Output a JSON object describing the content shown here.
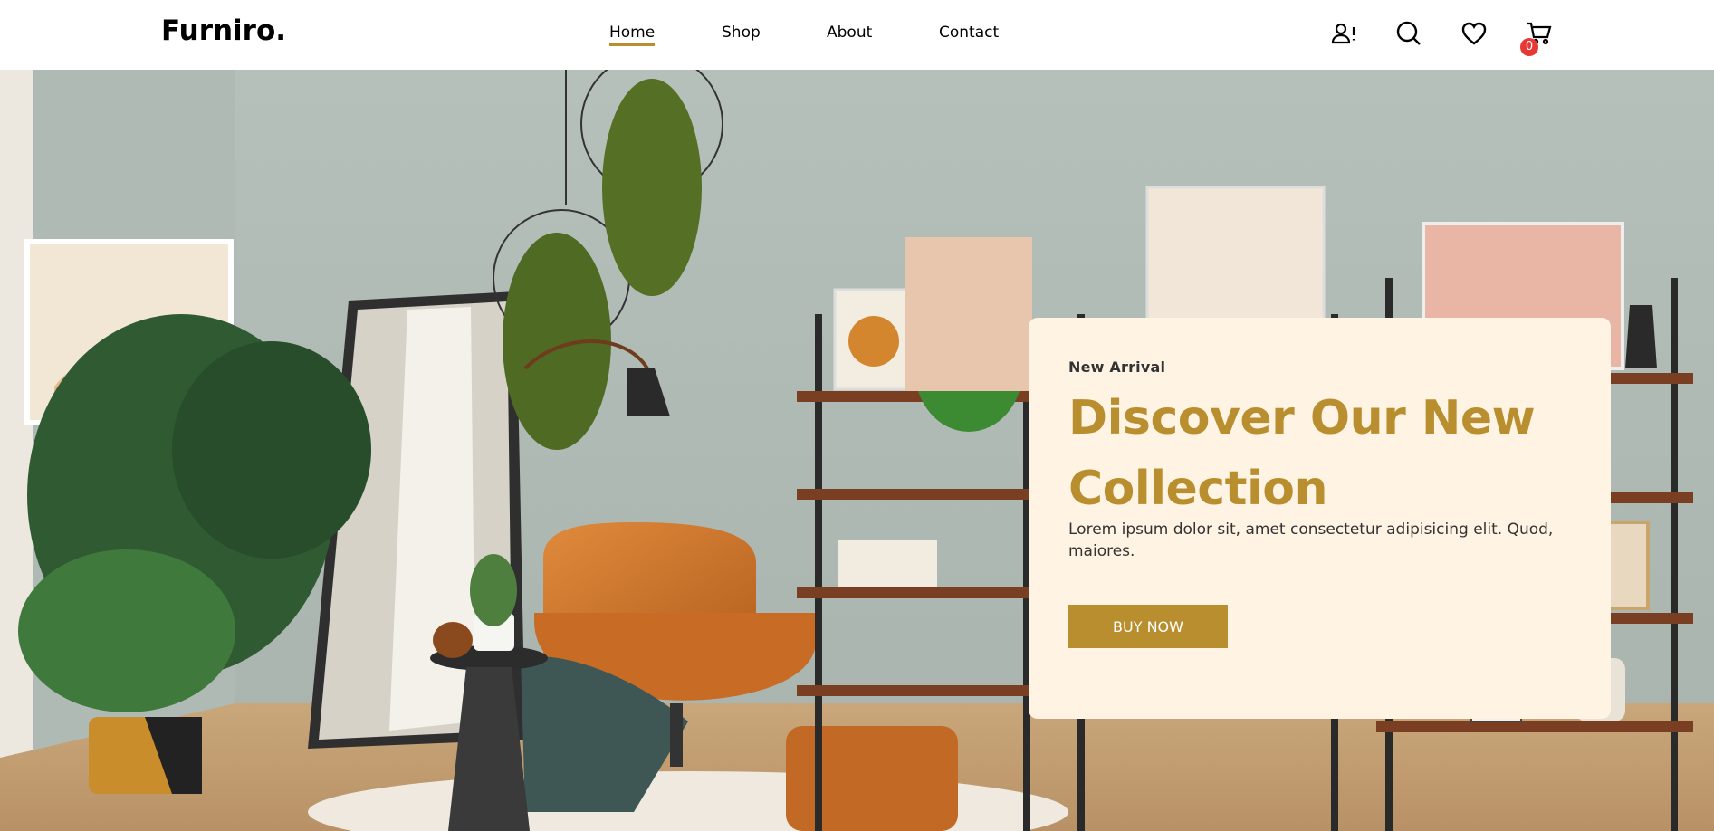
{
  "brand": {
    "logo": "Furniro."
  },
  "nav": {
    "items": [
      {
        "label": "Home",
        "active": true
      },
      {
        "label": "Shop",
        "active": false
      },
      {
        "label": "About",
        "active": false
      },
      {
        "label": "Contact",
        "active": false
      }
    ]
  },
  "header_icons": {
    "account": "account-alert-icon",
    "search": "search-icon",
    "wishlist": "heart-icon",
    "cart": "cart-icon",
    "cart_count": "0"
  },
  "hero": {
    "eyebrow": "New Arrival",
    "title": "Discover Our New Collection",
    "description": "Lorem ipsum dolor sit, amet consectetur adipisicing elit. Quod, maiores.",
    "cta_label": "BUY NOW"
  },
  "colors": {
    "accent": "#b88e2f",
    "card_background": "#fff3e3",
    "badge": "#e53935"
  }
}
